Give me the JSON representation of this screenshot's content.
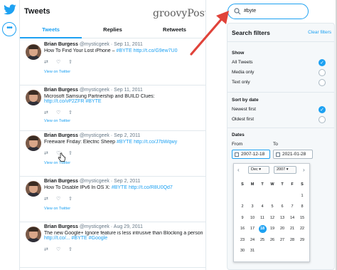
{
  "main": {
    "title": "Tweets",
    "watermark": "groovyPost.com",
    "tabs": [
      {
        "label": "Tweets",
        "active": true
      },
      {
        "label": "Replies",
        "active": false
      },
      {
        "label": "Retweets",
        "active": false
      }
    ]
  },
  "tweets": [
    {
      "name": "Brian Burgess",
      "handle": "@mysticgeek",
      "date": "· Sep 11, 2011",
      "text_plain": "How To Find Your Lost iPhone – ",
      "hashtag": "#BYTE",
      "link": "http://t.co/G9ew7U0",
      "link_first": false,
      "view": "View on Twitter"
    },
    {
      "name": "Brian Burgess",
      "handle": "@mysticgeek",
      "date": "· Sep 11, 2011",
      "text_plain": "Microsoft Samsung Partnership and BUILD Clues: ",
      "hashtag": "#BYTE",
      "link": "http://t.co/vP2ZFR",
      "link_first": true,
      "view": "View on Twitter"
    },
    {
      "name": "Brian Burgess",
      "handle": "@mysticgeek",
      "date": "· Sep 2, 2011",
      "text_plain": "Freeware Friday: Electric Sheep ",
      "hashtag": "#BYTE",
      "link": "http://t.co/J7bWqwy",
      "link_first": false,
      "view": "View on Twitter"
    },
    {
      "name": "Brian Burgess",
      "handle": "@mysticgeek",
      "date": "· Sep 2, 2011",
      "text_plain": "How To Disable IPv6 In OS X: ",
      "hashtag": "#BYTE",
      "link": "http://t.co/R8U0Qd7",
      "link_first": false,
      "view": "View on Twitter"
    },
    {
      "name": "Brian Burgess",
      "handle": "@mysticgeek",
      "date": "· Aug 29, 2011",
      "text_plain": "The new Google+ Ignore feature is less intrusive than Blocking a person - ",
      "hashtag": "#BYTE #Google",
      "link": "http://t.co/...",
      "link_first": true,
      "view": ""
    }
  ],
  "search": {
    "value": "#byte"
  },
  "filters": {
    "title": "Search filters",
    "clear": "Clear filters",
    "show_label": "Show",
    "show_options": [
      {
        "label": "All Tweets",
        "checked": true
      },
      {
        "label": "Media only",
        "checked": false
      },
      {
        "label": "Text only",
        "checked": false
      }
    ],
    "sort_label": "Sort by date",
    "sort_options": [
      {
        "label": "Newest first",
        "checked": true
      },
      {
        "label": "Oldest first",
        "checked": false
      }
    ],
    "dates_label": "Dates",
    "from_label": "From",
    "to_label": "To",
    "from_value": "2007-12-18",
    "to_value": "2021-01-28"
  },
  "picker": {
    "month": "Dec",
    "year": "2007",
    "prev": "‹",
    "next": "›",
    "dows": [
      "S",
      "M",
      "T",
      "W",
      "T",
      "F",
      "S"
    ],
    "weeks": [
      [
        "",
        "",
        "",
        "",
        "",
        "",
        "1"
      ],
      [
        "2",
        "3",
        "4",
        "5",
        "6",
        "7",
        "8"
      ],
      [
        "9",
        "10",
        "11",
        "12",
        "13",
        "14",
        "15"
      ],
      [
        "16",
        "17",
        "18",
        "19",
        "20",
        "21",
        "22"
      ],
      [
        "23",
        "24",
        "25",
        "26",
        "27",
        "28",
        "29"
      ],
      [
        "30",
        "31",
        "",
        "",
        "",
        "",
        ""
      ]
    ],
    "selected": "18"
  },
  "colors": {
    "accent": "#1da1f2",
    "arrow": "#e0433a"
  }
}
